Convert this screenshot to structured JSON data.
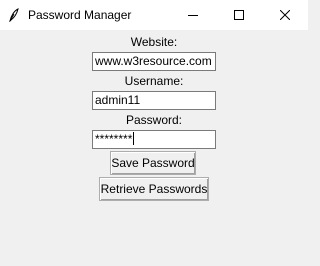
{
  "window": {
    "title": "Password Manager",
    "icons": {
      "app": "feather-icon",
      "minimize": "minimize-icon",
      "maximize": "maximize-icon",
      "close": "close-icon"
    }
  },
  "form": {
    "website_label": "Website:",
    "website_value": "www.w3resource.com",
    "username_label": "Username:",
    "username_value": "admin11",
    "password_label": "Password:",
    "password_value": "********"
  },
  "buttons": {
    "save_label": "Save Password",
    "retrieve_label": "Retrieve Passwords"
  }
}
